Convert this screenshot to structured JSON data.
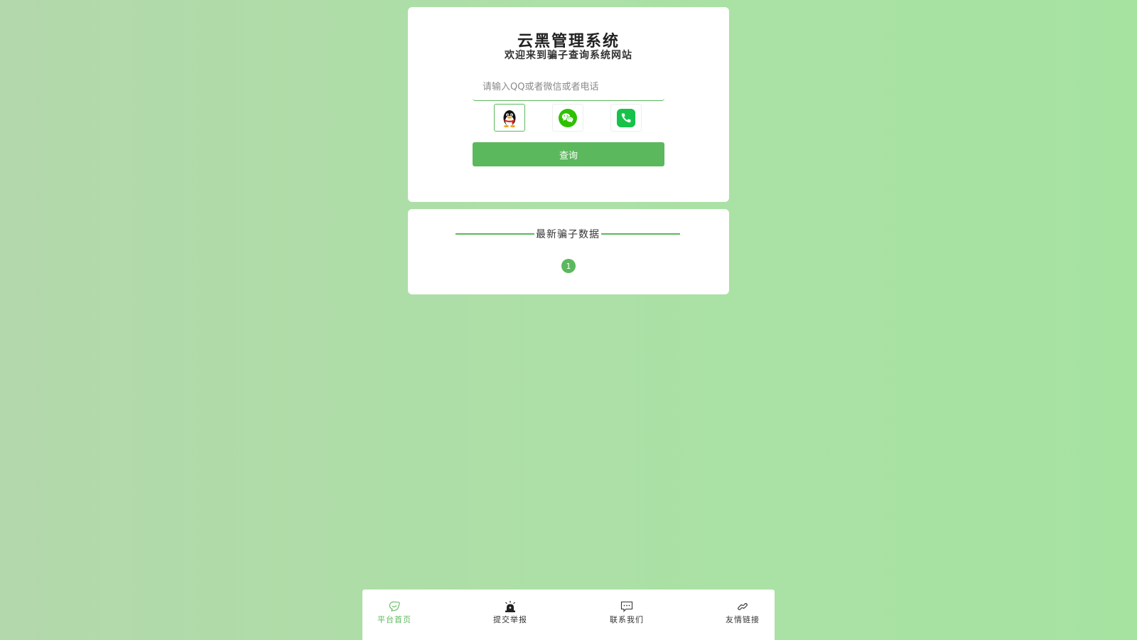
{
  "colors": {
    "accent": "#5cb85c",
    "card_background": "#ffffff",
    "background": "#ace0a6"
  },
  "search_card": {
    "title": "云黑管理系统",
    "subtitle": "欢迎来到骗子查询系统网站",
    "search_input": {
      "placeholder": "请输入QQ或者微信或者电话",
      "value": ""
    },
    "type_buttons": [
      {
        "icon": "qq-penguin-icon",
        "selected": true
      },
      {
        "icon": "wechat-icon",
        "selected": false
      },
      {
        "icon": "phone-icon",
        "selected": false
      }
    ],
    "query_button": "查询"
  },
  "data_card": {
    "heading": "最新骗子数据",
    "pagination": [
      "1"
    ]
  },
  "bottom_nav": {
    "items": [
      {
        "label": "平台首页",
        "icon": "home-icon",
        "active": true
      },
      {
        "label": "提交举报",
        "icon": "alarm-icon",
        "active": false
      },
      {
        "label": "联系我们",
        "icon": "chat-icon",
        "active": false
      },
      {
        "label": "友情链接",
        "icon": "link-icon",
        "active": false
      }
    ]
  }
}
